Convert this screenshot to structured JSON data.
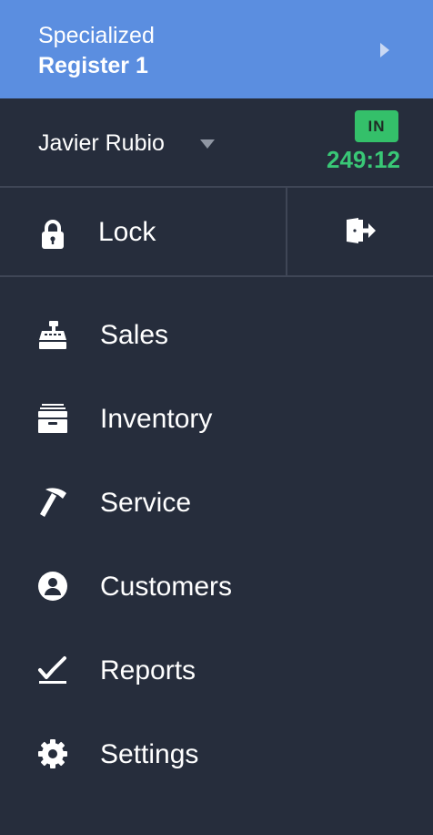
{
  "header": {
    "store": "Specialized",
    "register": "Register 1",
    "caret_icon": "caret-right-icon"
  },
  "user": {
    "name": "Javier Rubio",
    "status_badge": "IN",
    "clock_time": "249:12",
    "status_color": "#34c06a"
  },
  "actions": {
    "lock_label": "Lock",
    "lock_icon": "lock-icon",
    "logout_icon": "logout-icon"
  },
  "nav": {
    "items": [
      {
        "label": "Sales",
        "icon": "cash-register-icon"
      },
      {
        "label": "Inventory",
        "icon": "archive-box-icon"
      },
      {
        "label": "Service",
        "icon": "hammer-icon"
      },
      {
        "label": "Customers",
        "icon": "user-circle-icon"
      },
      {
        "label": "Reports",
        "icon": "chart-line-icon"
      },
      {
        "label": "Settings",
        "icon": "gear-icon"
      }
    ]
  },
  "colors": {
    "header_bg": "#5b8ee0",
    "sidebar_bg": "#262d3c"
  }
}
